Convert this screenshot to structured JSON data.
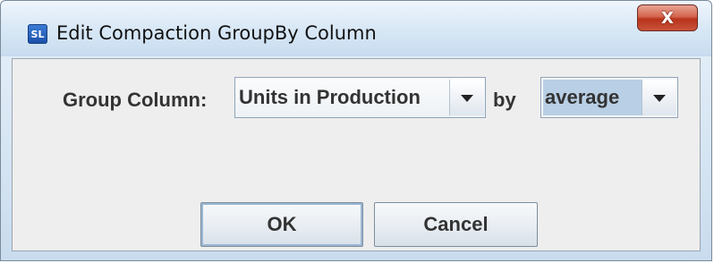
{
  "window": {
    "title": "Edit Compaction GroupBy Column",
    "icon_text": "SL",
    "close_symbol": "X"
  },
  "form": {
    "group_column_label": "Group Column:",
    "group_column_value": "Units in Production",
    "by_label": "by",
    "aggregate_value": "average"
  },
  "buttons": {
    "ok_label": "OK",
    "cancel_label": "Cancel"
  },
  "colors": {
    "selection_highlight": "#b8cfe5",
    "close_button": "#c9533b"
  }
}
